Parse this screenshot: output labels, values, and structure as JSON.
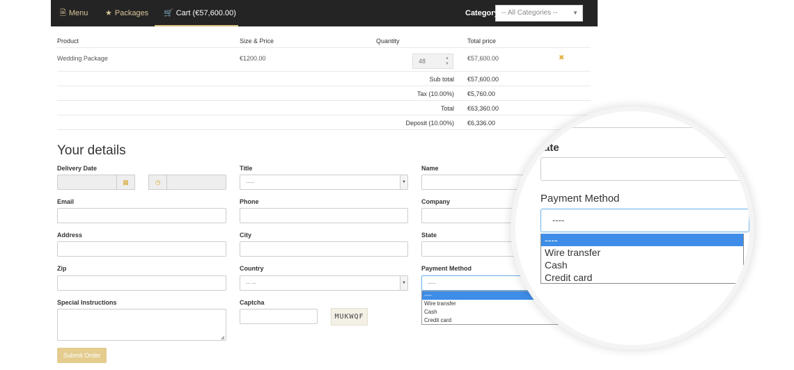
{
  "nav": {
    "items": [
      {
        "label": "Menu",
        "icon": "document-icon"
      },
      {
        "label": "Packages",
        "icon": "star-icon"
      },
      {
        "label": "Cart (€57,600.00)",
        "icon": "cart-icon"
      }
    ],
    "category_label": "Category",
    "category_value": "-- All Categories --"
  },
  "cart": {
    "headers": {
      "product": "Product",
      "size_price": "Size & Price",
      "quantity": "Quantity",
      "total": "Total price"
    },
    "row": {
      "product": "Wedding Package",
      "price": "€1200.00",
      "quantity": "48",
      "total": "€57,600.00"
    },
    "summary": [
      {
        "label": "Sub total",
        "value": "€57,600.00"
      },
      {
        "label": "Tax (10.00%)",
        "value": "€5,760.00"
      },
      {
        "label": "Total",
        "value": "€63,360.00"
      },
      {
        "label": "Deposit (10.00%)",
        "value": "€6,336.00"
      }
    ]
  },
  "form": {
    "heading": "Your details",
    "labels": {
      "delivery_date": "Delivery Date",
      "title": "Title",
      "name": "Name",
      "email": "Email",
      "phone": "Phone",
      "company": "Company",
      "address": "Address",
      "city": "City",
      "state": "State",
      "zip": "Zip",
      "country": "Country",
      "payment": "Payment Method",
      "instructions": "Special Instructions",
      "captcha": "Captcha"
    },
    "title_value": "----",
    "country_value": "-- --",
    "payment_value": "----",
    "payment_options": [
      "----",
      "Wire transfer",
      "Cash",
      "Credit card"
    ],
    "captcha_text": "MUKWQF",
    "submit_label": "Submit Order"
  },
  "magnifier": {
    "state_label_fragment": "tate",
    "payment_label": "Payment Method",
    "payment_value": "----",
    "payment_options": [
      "----",
      "Wire transfer",
      "Cash",
      "Credit card"
    ]
  },
  "colors": {
    "navbar": "#242424",
    "accent": "#d7be80",
    "selected_option": "#3e8de8",
    "submit": "#e3cc8e"
  }
}
